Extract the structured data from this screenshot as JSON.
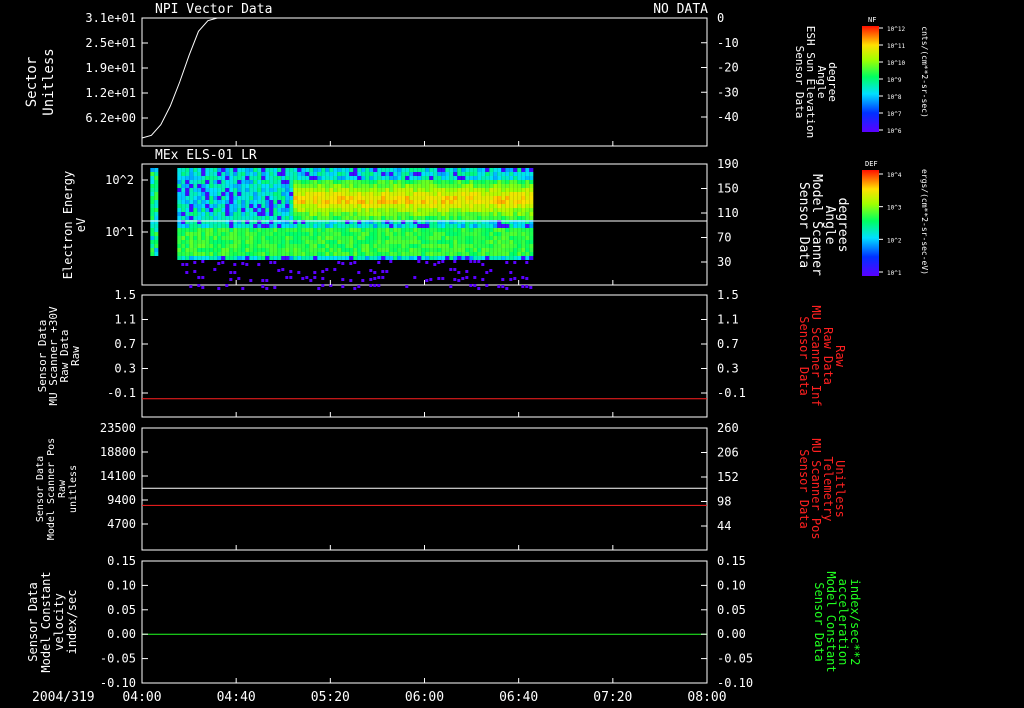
{
  "panel1": {
    "title": "NPI Vector Data",
    "status": "NO DATA",
    "left_label": [
      "Sector",
      "Unitless"
    ],
    "left_ticks": [
      "3.1e+01",
      "2.5e+01",
      "1.9e+01",
      "1.2e+01",
      "6.2e+00"
    ],
    "right_label": [
      "Sensor Data",
      "ESH Sun Elevation",
      "Angle",
      "degree"
    ],
    "right_ticks": [
      "0",
      "-10",
      "-20",
      "-30",
      "-40"
    ],
    "colorbar_label": "NF",
    "colorbar_ticks": [
      "10^12",
      "10^11",
      "10^10",
      "10^9",
      "10^8",
      "10^7",
      "10^6"
    ],
    "colorbar_units": "cnts/(cm**2-sr-sec)"
  },
  "panel2": {
    "title": "MEx ELS-01 LR",
    "left_label": [
      "Electron Energy",
      "eV"
    ],
    "left_ticks": [
      "10^2",
      "10^1"
    ],
    "right_label": [
      "Sensor Data",
      "Model Scanner",
      "Angle",
      "degrees"
    ],
    "right_ticks": [
      "190",
      "150",
      "110",
      "70",
      "30"
    ],
    "colorbar_label": "DEF",
    "colorbar_ticks": [
      "10^4",
      "10^3",
      "10^2",
      "10^1"
    ],
    "colorbar_units": "ergs/(cm**2-sr-sec-eV)"
  },
  "panel3": {
    "left_label": [
      "Sensor Data",
      "MU Scanner +30V",
      "Raw Data",
      "Raw"
    ],
    "left_ticks": [
      "1.5",
      "1.1",
      "0.7",
      "0.3",
      "-0.1"
    ],
    "right_label": [
      "Sensor Data",
      "MU Scanner Inf",
      "Raw Data",
      "Raw"
    ],
    "right_ticks": [
      "1.5",
      "1.1",
      "0.7",
      "0.3",
      "-0.1"
    ]
  },
  "panel4": {
    "left_label": [
      "Sensor Data",
      "Model Scanner Pos",
      "Raw",
      "unitless"
    ],
    "left_ticks": [
      "23500",
      "18800",
      "14100",
      "9400",
      "4700"
    ],
    "right_label": [
      "Sensor Data",
      "MU Scanner Pos",
      "Telemetry",
      "Unitless"
    ],
    "right_ticks": [
      "260",
      "206",
      "152",
      "98",
      "44"
    ]
  },
  "panel5": {
    "left_label": [
      "Sensor Data",
      "Model Constant",
      "velocity",
      "index/sec"
    ],
    "left_ticks": [
      "0.15",
      "0.10",
      "0.05",
      "0.00",
      "-0.05",
      "-0.10"
    ],
    "right_label": [
      "Sensor Data",
      "Model Constant",
      "acceleration",
      "index/sec**2"
    ],
    "right_ticks": [
      "0.15",
      "0.10",
      "0.05",
      "0.00",
      "-0.05",
      "-0.10"
    ]
  },
  "time_axis": {
    "date": "2004/319",
    "ticks": [
      "04:00",
      "04:40",
      "05:20",
      "06:00",
      "06:40",
      "07:20",
      "08:00"
    ]
  },
  "colors": {
    "axes": "#ffffff",
    "red_trace": "#ff2020",
    "green_trace": "#20ff20",
    "background": "#000000"
  },
  "chart_data": [
    {
      "type": "line",
      "title": "NPI Vector Data",
      "xlabel": "",
      "ylabel": "Sector Unitless",
      "y2label": "Sensor Data ESH Sun Elevation Angle degree",
      "xlim": [
        "04:00",
        "08:00"
      ],
      "ylim": [
        -48,
        0
      ],
      "series": [
        {
          "axis": "right",
          "x": [
            "04:00",
            "04:04",
            "04:08",
            "04:12",
            "04:16",
            "04:20",
            "04:24",
            "04:28",
            "04:32",
            "04:36",
            "04:40"
          ],
          "values": [
            -45,
            -44,
            -40,
            -33,
            -24,
            -14,
            -5,
            -1,
            0,
            0,
            0
          ]
        }
      ]
    },
    {
      "type": "heatmap",
      "title": "MEx ELS-01 LR",
      "xlabel": "",
      "ylabel": "Electron Energy eV",
      "y2label": "Sensor Data Model Scanner Angle degrees",
      "yscale": "log",
      "ylim": [
        1,
        200
      ],
      "data_extent": [
        "04:15",
        "06:45"
      ],
      "lines": [
        {
          "name": "",
          "axis": "right",
          "value": 97,
          "color": "#ffffff"
        }
      ]
    },
    {
      "type": "line",
      "ylim": [
        -0.3,
        1.5
      ],
      "series": [
        {
          "axis": "left",
          "x": [
            "04:00",
            "08:00"
          ],
          "values": [
            -0.03,
            -0.03
          ],
          "color": "#ff2020"
        }
      ]
    },
    {
      "type": "line",
      "ylim": [
        0,
        23500
      ],
      "series": [
        {
          "axis": "left",
          "x": [
            "04:00",
            "08:00"
          ],
          "values": [
            11900,
            11900
          ],
          "color": "#ffffff"
        },
        {
          "axis": "left",
          "x": [
            "04:00",
            "08:00"
          ],
          "values": [
            8600,
            8600
          ],
          "color": "#ff2020"
        }
      ]
    },
    {
      "type": "line",
      "ylim": [
        -0.1,
        0.15
      ],
      "series": [
        {
          "axis": "left",
          "x": [
            "04:00",
            "08:00"
          ],
          "values": [
            0.0,
            0.0
          ],
          "color": "#20ff20"
        }
      ]
    }
  ]
}
